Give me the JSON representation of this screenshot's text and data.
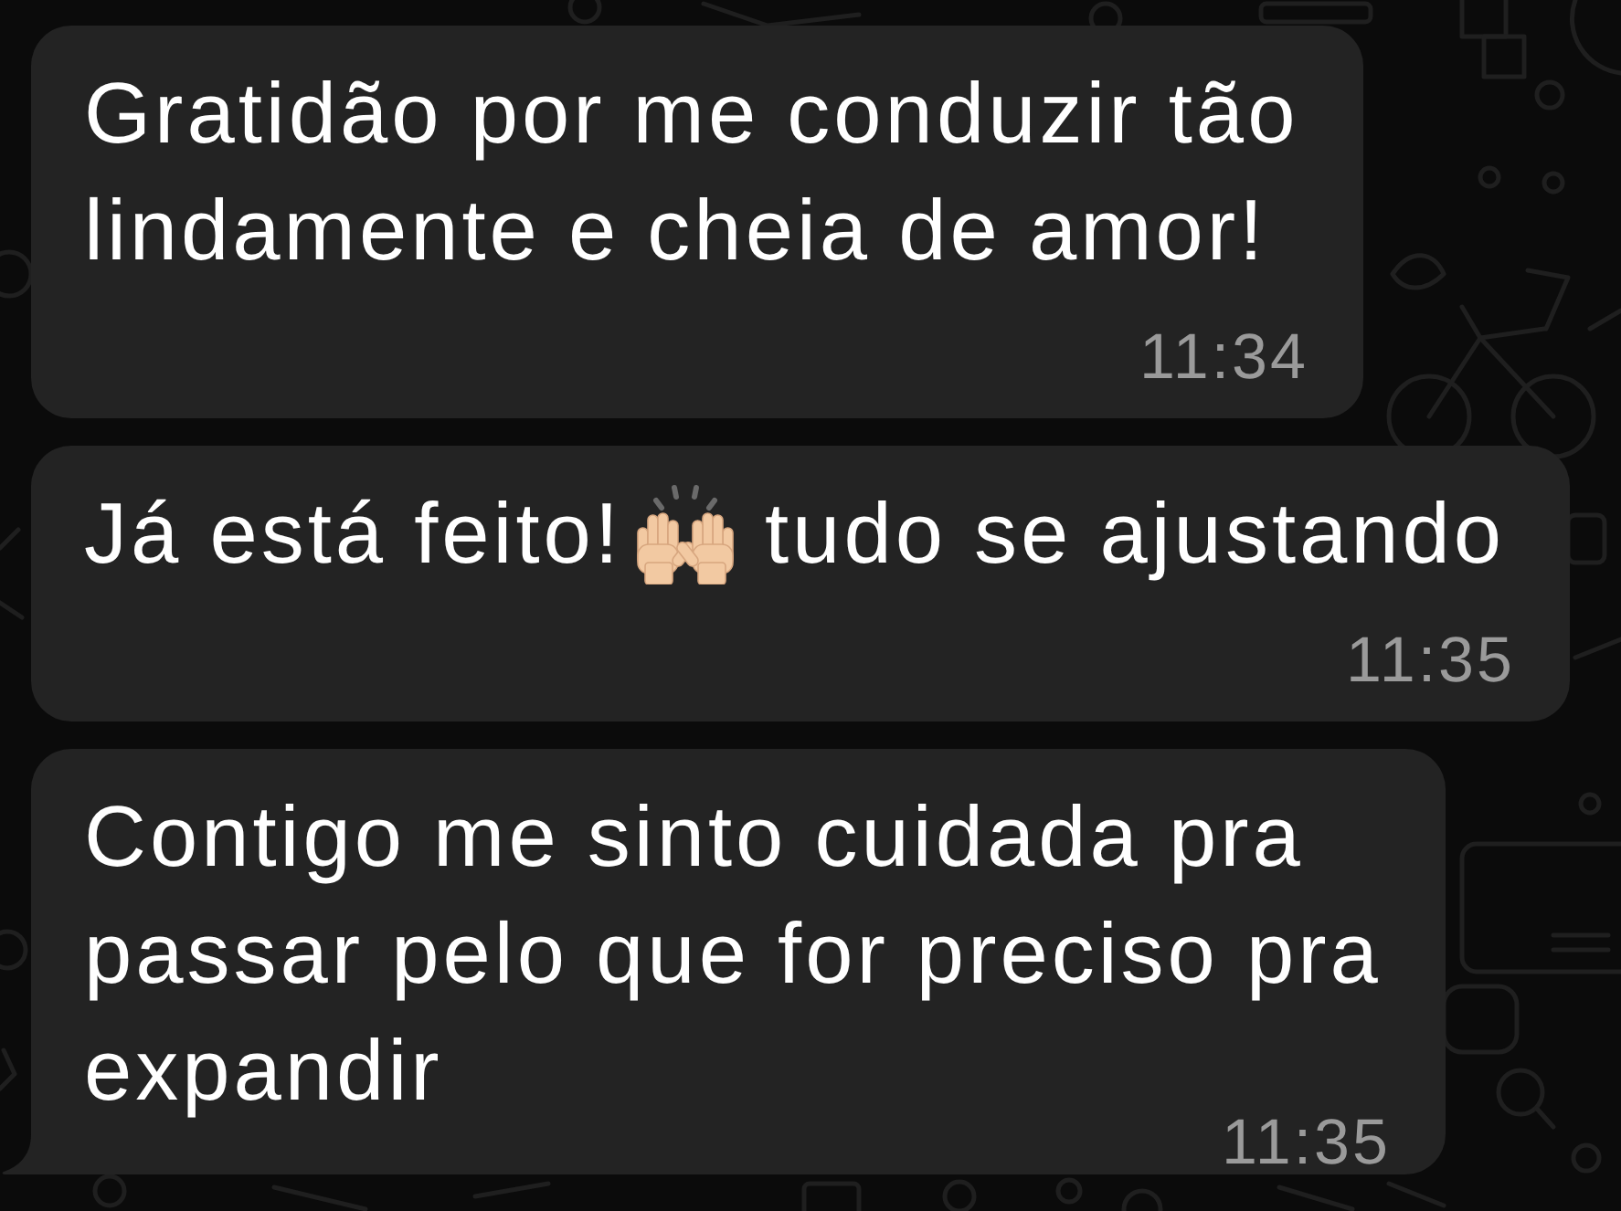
{
  "messages": [
    {
      "parts": [
        {
          "kind": "text",
          "text": "Gratidão por me conduzir tão lindamente e cheia de amor!"
        }
      ],
      "time": "11:34",
      "tail": false
    },
    {
      "parts": [
        {
          "kind": "text",
          "text": "Já está feito!"
        },
        {
          "kind": "emoji"
        },
        {
          "kind": "text",
          "text": "tudo se ajustando"
        }
      ],
      "time": "11:35",
      "tail": false
    },
    {
      "parts": [
        {
          "kind": "text",
          "text": "Contigo me sinto cuidada pra passar pelo que for preciso pra expandir"
        }
      ],
      "time": "11:35",
      "tail": true
    }
  ]
}
